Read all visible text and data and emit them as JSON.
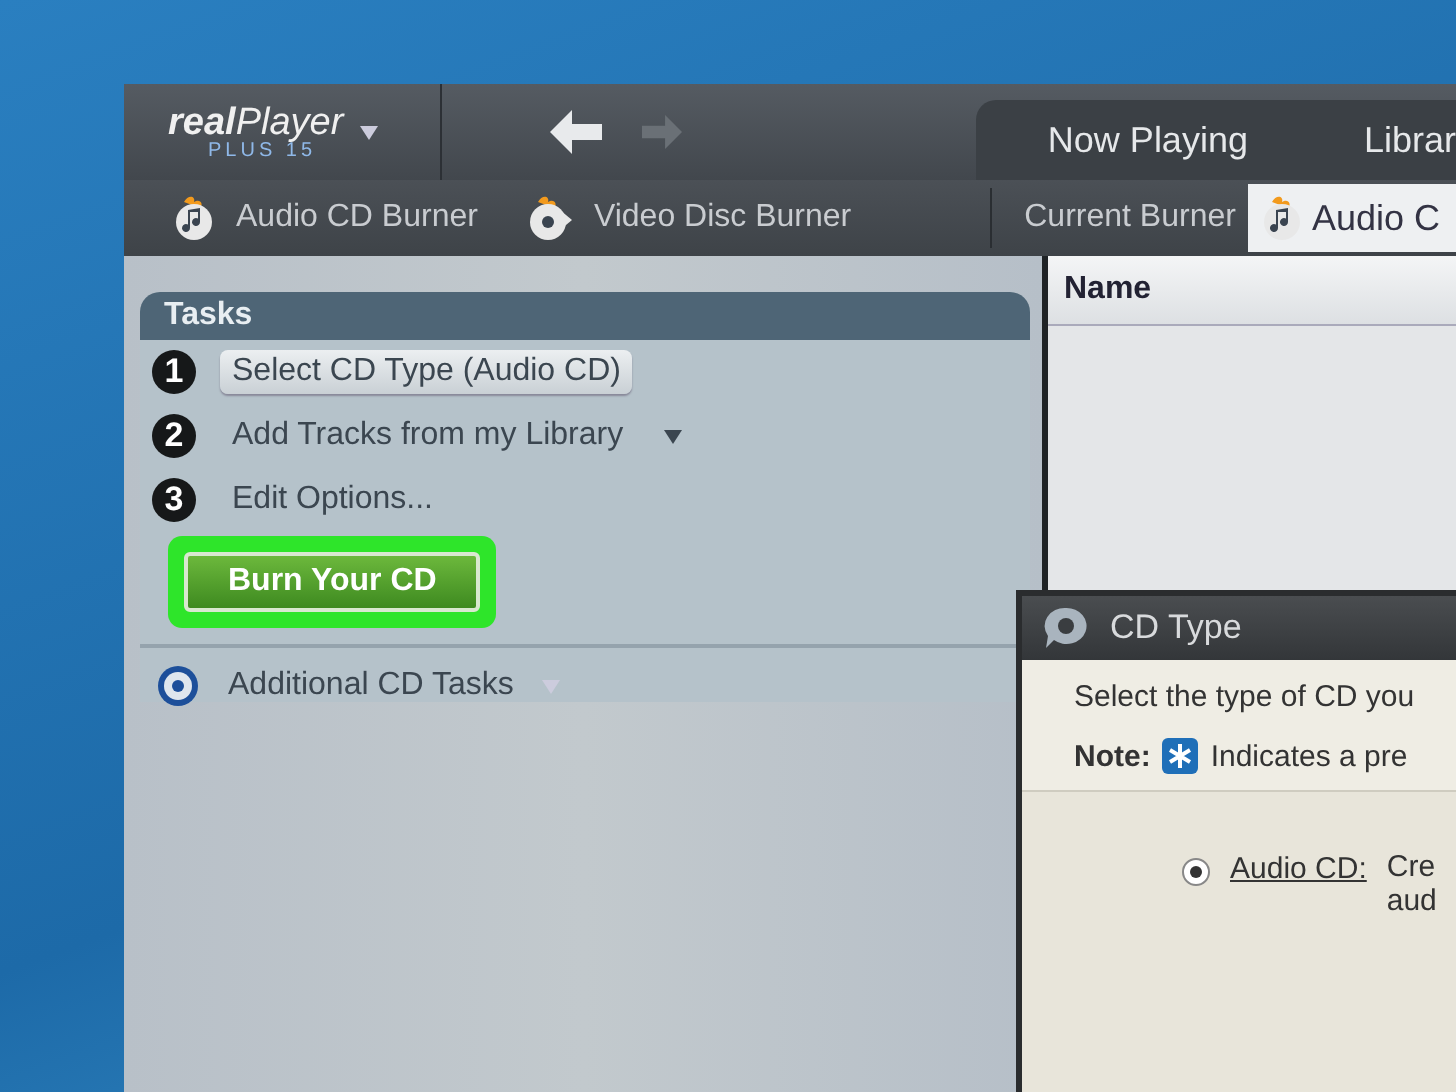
{
  "app": {
    "logo": "**real**Player",
    "edition": "PLUS 15"
  },
  "nav": {
    "back_disabled": false,
    "forward_disabled": true
  },
  "tabs": [
    {
      "label": "Now Playing",
      "selected": false
    },
    {
      "label": "Librar",
      "selected": false
    }
  ],
  "burner_bar": {
    "items": [
      {
        "label": "Audio CD Burner",
        "kind": "audio"
      },
      {
        "label": "Video Disc Burner",
        "kind": "video"
      }
    ],
    "current_label": "Current Burner",
    "tabs": [
      {
        "label": "Audio C",
        "selected": true
      }
    ]
  },
  "tasks": {
    "title": "Tasks",
    "steps": [
      {
        "number": "1",
        "label": "Select CD Type (Audio CD)",
        "kind": "button"
      },
      {
        "number": "2",
        "label": "Add Tracks from my Library",
        "kind": "dropdown"
      },
      {
        "number": "3",
        "label": "Edit Options...",
        "kind": "link"
      }
    ],
    "burn_button": {
      "label": "Burn Your CD",
      "highlighted": true
    },
    "additional": "Additional CD Tasks"
  },
  "track_list": {
    "columns": [
      "Name"
    ]
  },
  "dialog": {
    "title": "CD Type",
    "prompt": "Select the type of CD you",
    "note_label": "Note:",
    "note_text": "Indicates a pre",
    "options": [
      {
        "label": "Audio CD:",
        "description": [
          "Cre",
          "aud"
        ],
        "selected": true
      }
    ]
  }
}
